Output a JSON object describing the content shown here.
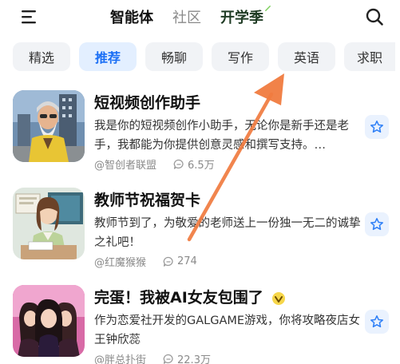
{
  "header": {
    "tabs": [
      {
        "label": "智能体",
        "state": "active"
      },
      {
        "label": "社区",
        "state": "inactive"
      },
      {
        "label": "开学季",
        "state": "promo"
      }
    ]
  },
  "categories": {
    "items": [
      "精选",
      "推荐",
      "畅聊",
      "写作",
      "英语",
      "求职"
    ],
    "selected": "推荐"
  },
  "agents": [
    {
      "title": "短视频创作助手",
      "description": "我是你的短视频创作小助手，无论你是新手还是老手，我都能为你提供创意灵感和撰写支持。…",
      "author": "@智创者联盟",
      "count": "6.5万"
    },
    {
      "title": "教师节祝福贺卡",
      "description": "教师节到了，为敬爱的老师送上一份独一无二的诚挚之礼吧！",
      "author": "@红魔猴猴",
      "count": "274"
    },
    {
      "title": "完蛋！我被AI女友包围了",
      "description": "作为恋爱社开发的GALGAME游戏，你将攻略夜店女王钟欣蕊",
      "author": "@胖总扑街",
      "count": "22.3万"
    }
  ],
  "icons": {
    "menu": "menu-icon",
    "search": "search-icon",
    "star": "star-icon",
    "comment": "comment-count-icon",
    "verified": "verified-badge-icon"
  },
  "colors": {
    "accent": "#1b6ff5",
    "chip_bg": "#f1f3f6",
    "chip_active_bg": "#e3efff",
    "annotation_arrow": "#f07b3f"
  }
}
